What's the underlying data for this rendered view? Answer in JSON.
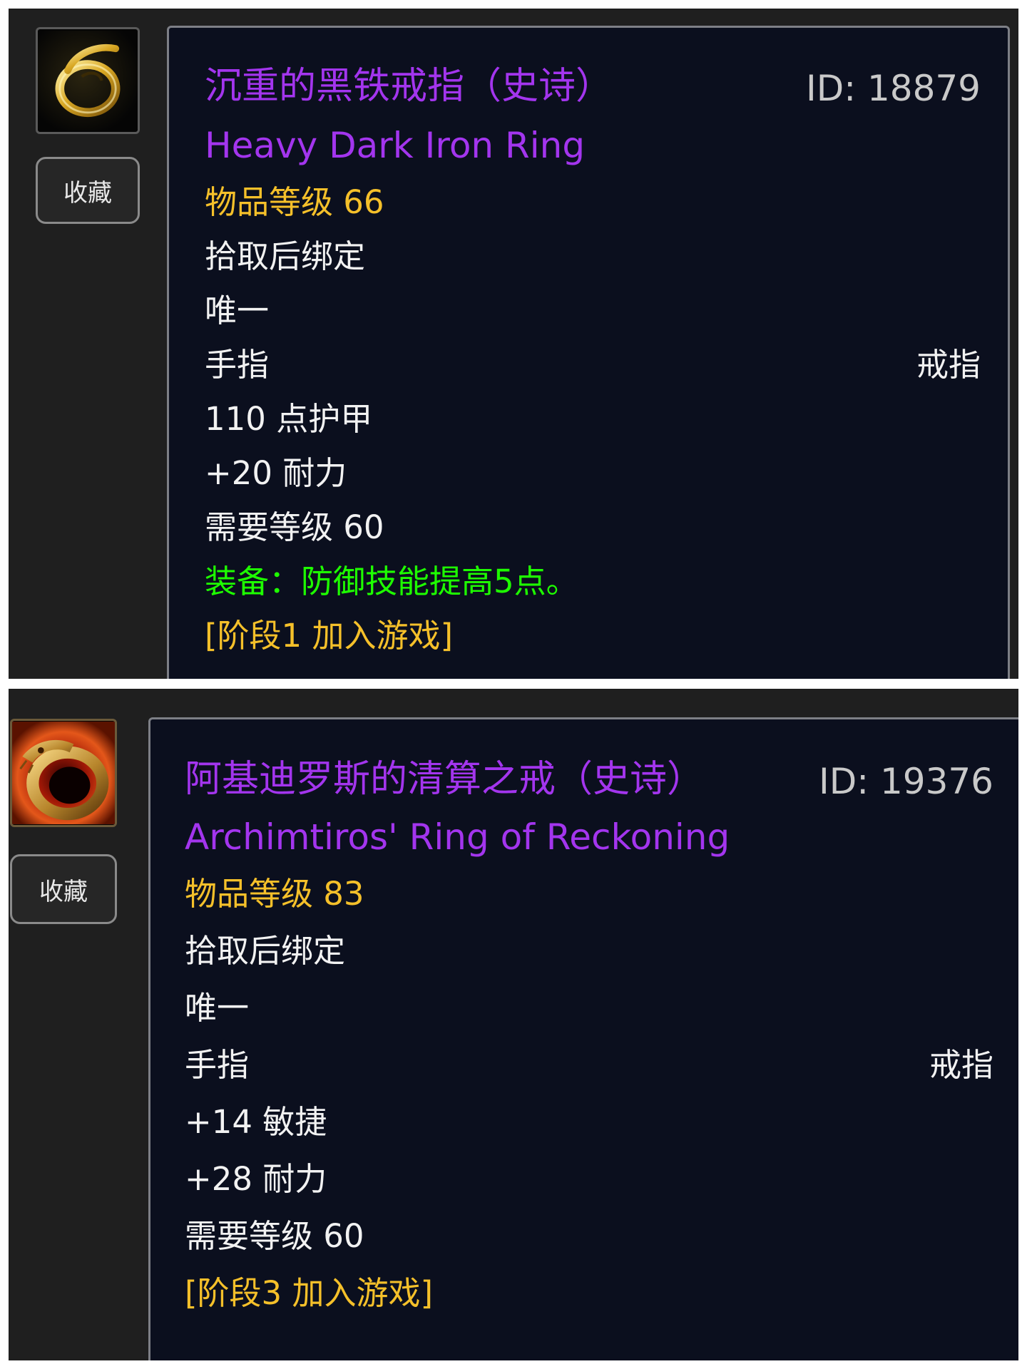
{
  "items": [
    {
      "icon": "ring-gold-swirl-icon",
      "favorite_label": "收藏",
      "name_cn": "沉重的黑铁戒指（史诗）",
      "name_en": "Heavy Dark Iron Ring",
      "id_text": "ID: 18879",
      "item_level": "物品等级 66",
      "binding": "拾取后绑定",
      "unique": "唯一",
      "slot": "手指",
      "slot_type": "戒指",
      "stats": [
        "110 点护甲",
        "+20 耐力"
      ],
      "required_level": "需要等级 60",
      "equip_effect": "装备：防御技能提高5点。",
      "phase": "[阶段1 加入游戏]"
    },
    {
      "icon": "ring-dragon-fire-icon",
      "favorite_label": "收藏",
      "name_cn": "阿基迪罗斯的清算之戒（史诗）",
      "name_en": "Archimtiros' Ring of Reckoning",
      "id_text": "ID: 19376",
      "item_level": "物品等级 83",
      "binding": "拾取后绑定",
      "unique": "唯一",
      "slot": "手指",
      "slot_type": "戒指",
      "stats": [
        "+14 敏捷",
        "+28 耐力"
      ],
      "required_level": "需要等级 60",
      "phase": "[阶段3 加入游戏]"
    }
  ],
  "colors": {
    "epic_purple": "#a335ee",
    "item_level_gold": "#f5c02a",
    "equip_green": "#1eff00",
    "tooltip_bg": "#0b0f1e",
    "panel_bg": "#1f1f1f"
  }
}
